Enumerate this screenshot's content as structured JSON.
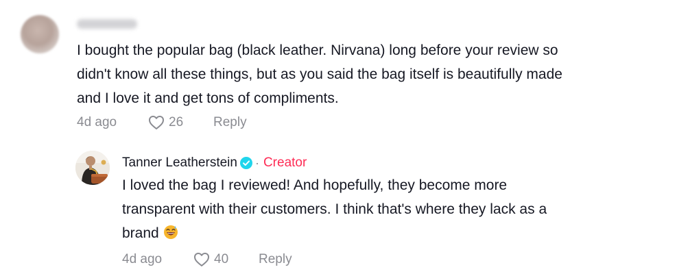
{
  "comments": [
    {
      "text": "I bought the popular bag (black leather. Nirvana) long before your review so\ndidn't know all these things, but as you said the bag itself is beautifully made\nand I love it and get tons of compliments.",
      "time": "4d ago",
      "likes": "26",
      "reply_label": "Reply"
    },
    {
      "author": "Tanner Leatherstein",
      "badge_separator": "·",
      "badge": "Creator",
      "text": "I loved the bag I reviewed! And hopefully, they become more\ntransparent with their customers. I think that's where they lack as a\nbrand",
      "emoji": "grinning-sweat-emoji",
      "time": "4d ago",
      "likes": "40",
      "reply_label": "Reply"
    }
  ],
  "colors": {
    "text": "#161823",
    "muted": "#8a8b91",
    "creator": "#fe2c55",
    "verified": "#20d5ec"
  },
  "icons": [
    "heart-outline-icon",
    "verified-check-icon"
  ]
}
